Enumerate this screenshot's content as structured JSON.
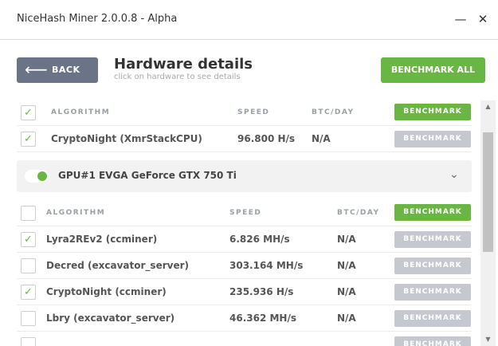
{
  "window": {
    "title": "NiceHash Miner 2.0.0.8 - Alpha",
    "minimize": "—",
    "close": "✕"
  },
  "header": {
    "back_label": "BACK",
    "back_arrow": "⟵",
    "title": "Hardware details",
    "subtitle": "click on hardware to see details",
    "benchmark_all_label": "BENCHMARK ALL"
  },
  "cpu_table": {
    "headers": {
      "algorithm": "ALGORITHM",
      "speed": "SPEED",
      "btc": "BTC/DAY",
      "benchmark": "BENCHMARK"
    },
    "header_checked": true,
    "rows": [
      {
        "checked": true,
        "algorithm": "CryptoNight (XmrStackCPU)",
        "speed": "96.800 H/s",
        "btc": "N/A",
        "button": "BENCHMARK"
      }
    ]
  },
  "gpu": {
    "name": "GPU#1 EVGA GeForce GTX 750 Ti",
    "enabled": true,
    "chevron": "⌄"
  },
  "gpu_table": {
    "headers": {
      "algorithm": "ALGORITHM",
      "speed": "SPEED",
      "btc": "BTC/DAY",
      "benchmark": "BENCHMARK"
    },
    "header_checked": false,
    "rows": [
      {
        "checked": true,
        "algorithm": "Lyra2REv2 (ccminer)",
        "speed": "6.826 MH/s",
        "btc": "N/A",
        "button": "BENCHMARK"
      },
      {
        "checked": false,
        "algorithm": "Decred (excavator_server)",
        "speed": "303.164 MH/s",
        "btc": "N/A",
        "button": "BENCHMARK"
      },
      {
        "checked": true,
        "algorithm": "CryptoNight (ccminer)",
        "speed": "235.936 H/s",
        "btc": "N/A",
        "button": "BENCHMARK"
      },
      {
        "checked": false,
        "algorithm": "Lbry (excavator_server)",
        "speed": "46.362 MH/s",
        "btc": "N/A",
        "button": "BENCHMARK"
      }
    ]
  },
  "scrollbar": {
    "up": "▲",
    "down": "▼"
  },
  "check_glyph": "✓",
  "colors": {
    "accent_green": "#6ab645",
    "back_button": "#6b7487",
    "disabled_button": "#c5c9cf"
  }
}
